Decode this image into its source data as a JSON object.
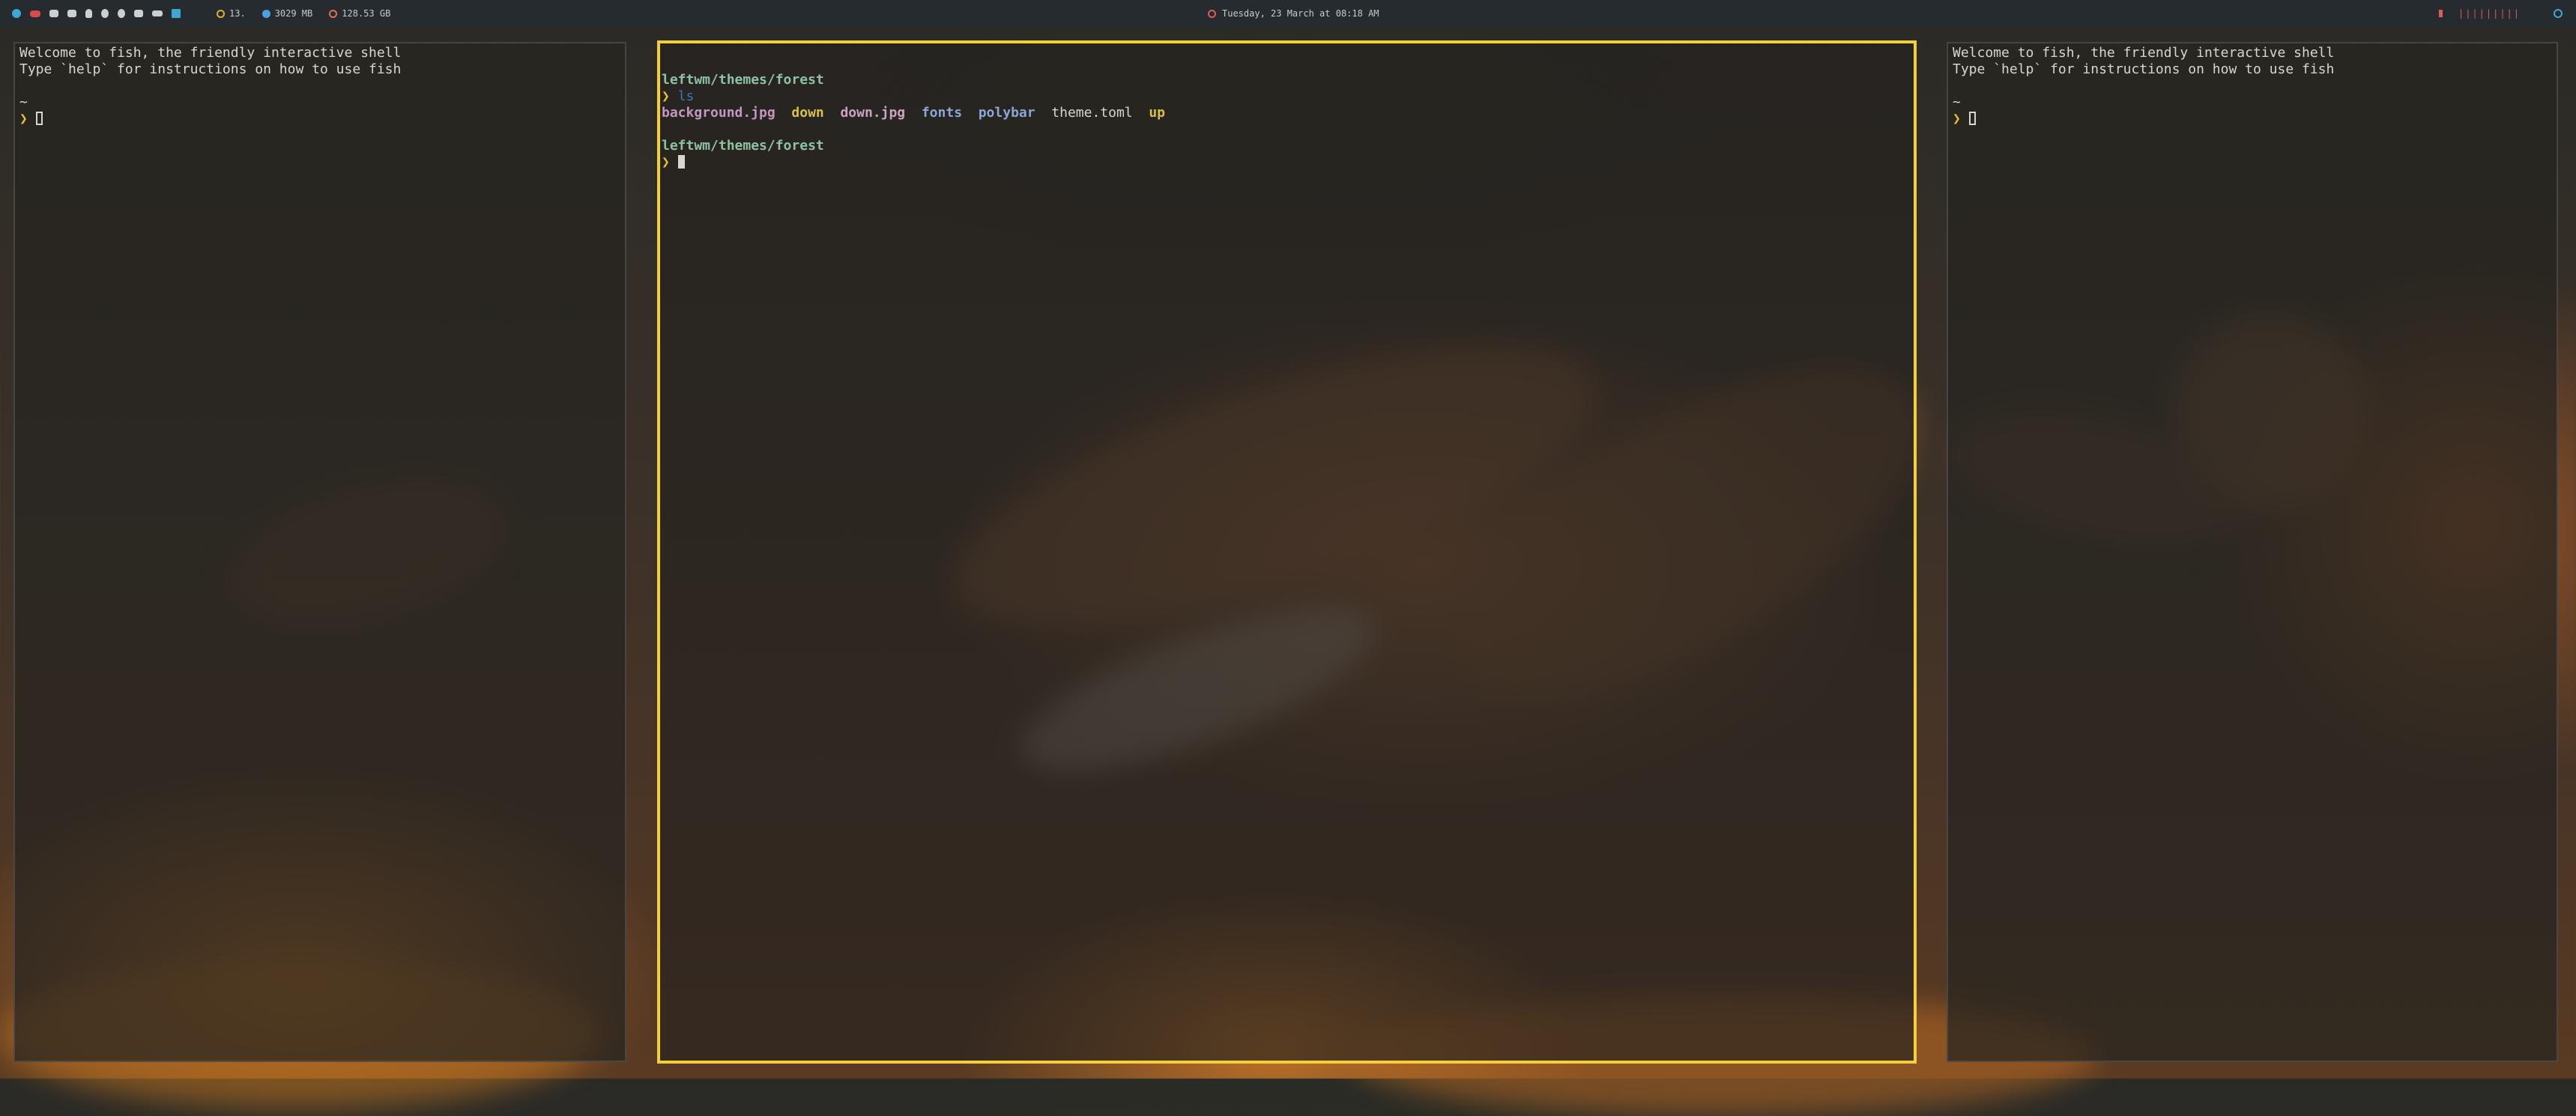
{
  "topbar": {
    "workspace_icons": [
      "settings-icon",
      "game-icon",
      "terminal-icon",
      "files-icon",
      "linux-icon",
      "apple-icon",
      "editor-icon",
      "bed-icon",
      "windows-icon"
    ],
    "cpu_temp": "13.",
    "memory": "3029 MB",
    "disk": "128.53 GB",
    "datetime": "Tuesday, 23 March at 08:18 AM",
    "volume_bars": "|||||||||",
    "colors": {
      "clock": "#e05a5a",
      "volume": "#e05a5a",
      "temp": "#e0b030",
      "mem": "#4aa0e0",
      "disk": "#e07050"
    }
  },
  "terminals": {
    "left": {
      "welcome1": "Welcome to fish, the friendly interactive shell",
      "welcome2": "Type `help` for instructions on how to use fish",
      "cwd": "~",
      "prompt": "❯"
    },
    "center": {
      "cwd": "leftwm/themes/forest",
      "prompt": "❯",
      "command": "ls",
      "listing": [
        {
          "name": "background.jpg",
          "kind": "image"
        },
        {
          "name": "down",
          "kind": "exec"
        },
        {
          "name": "down.jpg",
          "kind": "image"
        },
        {
          "name": "fonts",
          "kind": "dir"
        },
        {
          "name": "polybar",
          "kind": "dir"
        },
        {
          "name": "theme.toml",
          "kind": "file"
        },
        {
          "name": "up",
          "kind": "exec"
        }
      ],
      "cwd2": "leftwm/themes/forest",
      "active_border": "#f3cf3c"
    },
    "right": {
      "welcome1": "Welcome to fish, the friendly interactive shell",
      "welcome2": "Type `help` for instructions on how to use fish",
      "cwd": "~",
      "prompt": "❯"
    }
  }
}
